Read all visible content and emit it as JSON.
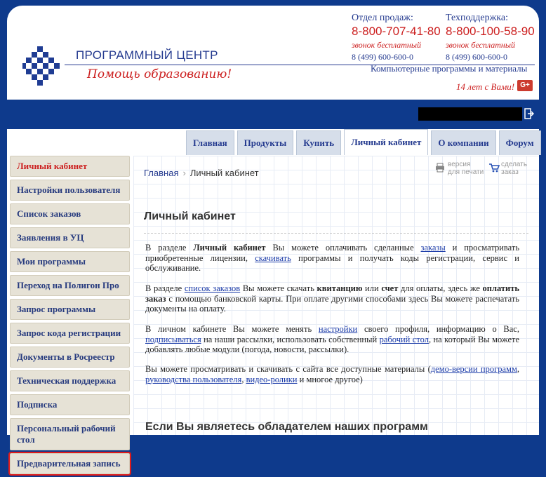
{
  "header": {
    "logo_name": "ПРОГРАММНЫЙ ЦЕНТР",
    "logo_slogan": "Помощь образованию!",
    "sales": {
      "label": "Отдел продаж:",
      "phone": "8-800-707-41-80",
      "free": "звонок бесплатный",
      "local": "8 (499) 600-600-0"
    },
    "support": {
      "label": "Техподдержка:",
      "phone": "8-800-100-58-90",
      "free": "звонок бесплатный",
      "local": "8 (499) 600-600-0"
    },
    "software": "Компьютерные программы и материалы",
    "years": "14 лет с Вами!",
    "gplus": "G+"
  },
  "tabs": [
    {
      "label": "Главная"
    },
    {
      "label": "Продукты"
    },
    {
      "label": "Купить"
    },
    {
      "label": "Личный кабинет",
      "active": true
    },
    {
      "label": "О компании"
    },
    {
      "label": "Форум"
    }
  ],
  "sidebar": {
    "items": [
      {
        "label": "Личный кабинет",
        "current": true
      },
      {
        "label": "Настройки пользователя"
      },
      {
        "label": "Список заказов"
      },
      {
        "label": "Заявления в УЦ"
      },
      {
        "label": "Мои программы"
      },
      {
        "label": "Переход на Полигон Про"
      },
      {
        "label": "Запрос программы"
      },
      {
        "label": "Запрос кода регистрации"
      },
      {
        "label": "Документы в Росреестр"
      },
      {
        "label": "Техническая поддержка"
      },
      {
        "label": "Подписка"
      },
      {
        "label": "Персональный рабочий стол"
      },
      {
        "label": "Предварительная запись",
        "highlighted": true
      }
    ]
  },
  "breadcrumb": {
    "home": "Главная",
    "sep": "›",
    "current": "Личный кабинет"
  },
  "tools": {
    "print": {
      "line1": "версия",
      "line2": "для печати"
    },
    "order": {
      "line1": "сделать",
      "line2": "заказ"
    }
  },
  "main": {
    "title": "Личный кабинет",
    "p1": {
      "t1": "В разделе ",
      "b1": "Личный кабинет",
      "t2": " Вы можете оплачивать сделанные ",
      "a1": "заказы",
      "t3": " и просматривать приобретенные лицензии, ",
      "a2": "скачивать",
      "t4": " программы и получать коды регистрации, сервис и обслуживание."
    },
    "p2": {
      "t1": "В разделе ",
      "a1": "список заказов",
      "t2": " Вы можете скачать ",
      "b1": "квитанцию",
      "t3": " или ",
      "b2": "счет",
      "t4": " для оплаты, здесь же ",
      "b3": "оплатить заказ",
      "t5": " с помощью банковской карты. При оплате другими способами здесь Вы можете распечатать документы на оплату."
    },
    "p3": {
      "t1": "В личном кабинете Вы можете менять ",
      "a1": "настройки",
      "t2": " своего профиля, информацию о Вас, ",
      "a2": "подписываться",
      "t3": " на наши рассылки, использовать собственный ",
      "a3": "рабочий стол",
      "t4": ", на который Вы можете добавлять любые модули (погода, новости, рассылки)."
    },
    "p4": {
      "t1": "Вы можете просматривать и скачивать с сайта все доступные материалы (",
      "a1": "демо-версии программ",
      "t2": ", ",
      "a2": "руководства пользователя",
      "t3": ", ",
      "a3": "видео-ролики",
      "t4": " и многое другое)"
    },
    "subtitle": "Если Вы являетесь обладателем наших программ"
  },
  "colors": {
    "brand_blue": "#0e3a8c",
    "accent_red": "#cc1f1f",
    "sidebar_bg": "#e6e2d6",
    "tab_bg": "#d6deea"
  }
}
